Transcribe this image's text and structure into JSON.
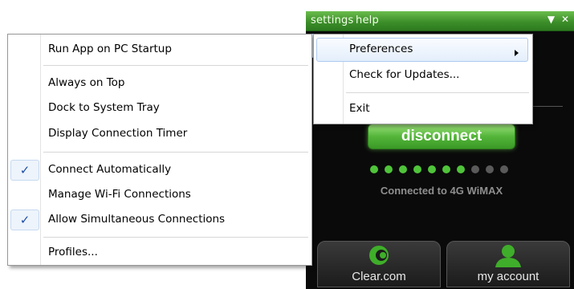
{
  "app": {
    "menu_settings": "settings",
    "menu_help": "help",
    "window_icons": [
      "▼",
      "✕"
    ],
    "disconnect_label": "disconnect",
    "signal": {
      "total": 10,
      "active": 7
    },
    "status": "Connected to 4G WiMAX",
    "clear_label": "Clear.com",
    "account_label": "my account",
    "accent_color": "#4fc43a"
  },
  "context_menu": {
    "items": [
      {
        "label": "Run App on PC Startup",
        "checked": false
      },
      {
        "label": "Always on Top",
        "checked": false
      },
      {
        "label": "Dock to System Tray",
        "checked": false
      },
      {
        "label": "Display Connection Timer",
        "checked": false
      },
      {
        "label": "Connect Automatically",
        "checked": true
      },
      {
        "label": "Manage Wi-Fi Connections",
        "checked": false
      },
      {
        "label": "Allow Simultaneous Connections",
        "checked": true
      },
      {
        "label": "Profiles...",
        "checked": false
      }
    ],
    "check_glyph": "✓"
  },
  "submenu": {
    "items": [
      {
        "label": "Preferences",
        "has_submenu": true
      },
      {
        "label": "Check for Updates...",
        "has_submenu": false
      },
      {
        "label": "Exit",
        "has_submenu": false
      }
    ]
  }
}
